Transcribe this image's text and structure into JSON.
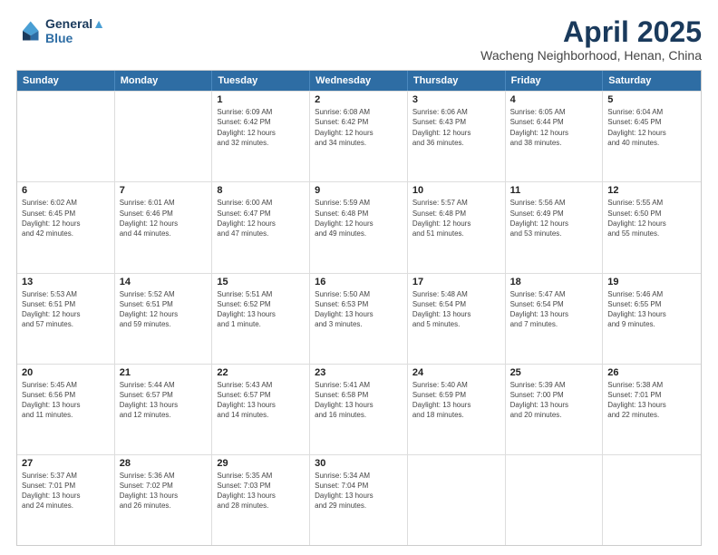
{
  "header": {
    "logo_line1": "General",
    "logo_line2": "Blue",
    "month": "April 2025",
    "location": "Wacheng Neighborhood, Henan, China"
  },
  "weekdays": [
    "Sunday",
    "Monday",
    "Tuesday",
    "Wednesday",
    "Thursday",
    "Friday",
    "Saturday"
  ],
  "rows": [
    [
      {
        "day": "",
        "info": ""
      },
      {
        "day": "",
        "info": ""
      },
      {
        "day": "1",
        "info": "Sunrise: 6:09 AM\nSunset: 6:42 PM\nDaylight: 12 hours\nand 32 minutes."
      },
      {
        "day": "2",
        "info": "Sunrise: 6:08 AM\nSunset: 6:42 PM\nDaylight: 12 hours\nand 34 minutes."
      },
      {
        "day": "3",
        "info": "Sunrise: 6:06 AM\nSunset: 6:43 PM\nDaylight: 12 hours\nand 36 minutes."
      },
      {
        "day": "4",
        "info": "Sunrise: 6:05 AM\nSunset: 6:44 PM\nDaylight: 12 hours\nand 38 minutes."
      },
      {
        "day": "5",
        "info": "Sunrise: 6:04 AM\nSunset: 6:45 PM\nDaylight: 12 hours\nand 40 minutes."
      }
    ],
    [
      {
        "day": "6",
        "info": "Sunrise: 6:02 AM\nSunset: 6:45 PM\nDaylight: 12 hours\nand 42 minutes."
      },
      {
        "day": "7",
        "info": "Sunrise: 6:01 AM\nSunset: 6:46 PM\nDaylight: 12 hours\nand 44 minutes."
      },
      {
        "day": "8",
        "info": "Sunrise: 6:00 AM\nSunset: 6:47 PM\nDaylight: 12 hours\nand 47 minutes."
      },
      {
        "day": "9",
        "info": "Sunrise: 5:59 AM\nSunset: 6:48 PM\nDaylight: 12 hours\nand 49 minutes."
      },
      {
        "day": "10",
        "info": "Sunrise: 5:57 AM\nSunset: 6:48 PM\nDaylight: 12 hours\nand 51 minutes."
      },
      {
        "day": "11",
        "info": "Sunrise: 5:56 AM\nSunset: 6:49 PM\nDaylight: 12 hours\nand 53 minutes."
      },
      {
        "day": "12",
        "info": "Sunrise: 5:55 AM\nSunset: 6:50 PM\nDaylight: 12 hours\nand 55 minutes."
      }
    ],
    [
      {
        "day": "13",
        "info": "Sunrise: 5:53 AM\nSunset: 6:51 PM\nDaylight: 12 hours\nand 57 minutes."
      },
      {
        "day": "14",
        "info": "Sunrise: 5:52 AM\nSunset: 6:51 PM\nDaylight: 12 hours\nand 59 minutes."
      },
      {
        "day": "15",
        "info": "Sunrise: 5:51 AM\nSunset: 6:52 PM\nDaylight: 13 hours\nand 1 minute."
      },
      {
        "day": "16",
        "info": "Sunrise: 5:50 AM\nSunset: 6:53 PM\nDaylight: 13 hours\nand 3 minutes."
      },
      {
        "day": "17",
        "info": "Sunrise: 5:48 AM\nSunset: 6:54 PM\nDaylight: 13 hours\nand 5 minutes."
      },
      {
        "day": "18",
        "info": "Sunrise: 5:47 AM\nSunset: 6:54 PM\nDaylight: 13 hours\nand 7 minutes."
      },
      {
        "day": "19",
        "info": "Sunrise: 5:46 AM\nSunset: 6:55 PM\nDaylight: 13 hours\nand 9 minutes."
      }
    ],
    [
      {
        "day": "20",
        "info": "Sunrise: 5:45 AM\nSunset: 6:56 PM\nDaylight: 13 hours\nand 11 minutes."
      },
      {
        "day": "21",
        "info": "Sunrise: 5:44 AM\nSunset: 6:57 PM\nDaylight: 13 hours\nand 12 minutes."
      },
      {
        "day": "22",
        "info": "Sunrise: 5:43 AM\nSunset: 6:57 PM\nDaylight: 13 hours\nand 14 minutes."
      },
      {
        "day": "23",
        "info": "Sunrise: 5:41 AM\nSunset: 6:58 PM\nDaylight: 13 hours\nand 16 minutes."
      },
      {
        "day": "24",
        "info": "Sunrise: 5:40 AM\nSunset: 6:59 PM\nDaylight: 13 hours\nand 18 minutes."
      },
      {
        "day": "25",
        "info": "Sunrise: 5:39 AM\nSunset: 7:00 PM\nDaylight: 13 hours\nand 20 minutes."
      },
      {
        "day": "26",
        "info": "Sunrise: 5:38 AM\nSunset: 7:01 PM\nDaylight: 13 hours\nand 22 minutes."
      }
    ],
    [
      {
        "day": "27",
        "info": "Sunrise: 5:37 AM\nSunset: 7:01 PM\nDaylight: 13 hours\nand 24 minutes."
      },
      {
        "day": "28",
        "info": "Sunrise: 5:36 AM\nSunset: 7:02 PM\nDaylight: 13 hours\nand 26 minutes."
      },
      {
        "day": "29",
        "info": "Sunrise: 5:35 AM\nSunset: 7:03 PM\nDaylight: 13 hours\nand 28 minutes."
      },
      {
        "day": "30",
        "info": "Sunrise: 5:34 AM\nSunset: 7:04 PM\nDaylight: 13 hours\nand 29 minutes."
      },
      {
        "day": "",
        "info": ""
      },
      {
        "day": "",
        "info": ""
      },
      {
        "day": "",
        "info": ""
      }
    ]
  ]
}
